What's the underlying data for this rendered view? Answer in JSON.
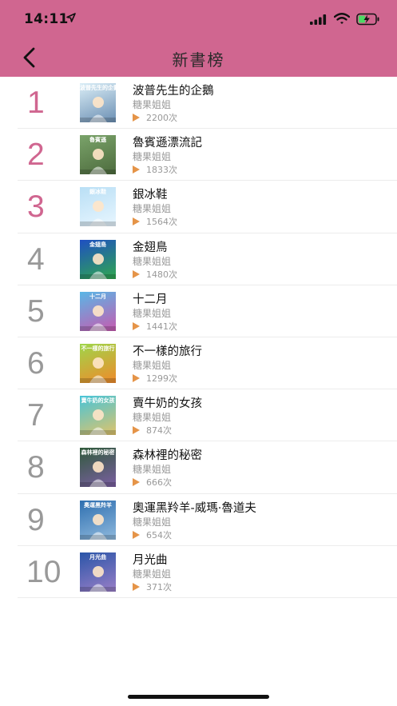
{
  "status_bar": {
    "time": "14:11"
  },
  "nav": {
    "title": "新書榜"
  },
  "books": [
    {
      "rank": "1",
      "title": "波普先生的企鵝",
      "author": "糖果姐姐",
      "plays": "2200次",
      "cover_text": "波普先生的企鵝",
      "cover_colors": [
        "#dbeef7",
        "#6b8fb3"
      ]
    },
    {
      "rank": "2",
      "title": "魯賓遜漂流記",
      "author": "糖果姐姐",
      "plays": "1833次",
      "cover_text": "魯賓遜",
      "cover_colors": [
        "#7aa36a",
        "#4d6b3d"
      ]
    },
    {
      "rank": "3",
      "title": "銀冰鞋",
      "author": "糖果姐姐",
      "plays": "1564次",
      "cover_text": "銀冰鞋",
      "cover_colors": [
        "#b9dff5",
        "#e8f6ff"
      ]
    },
    {
      "rank": "4",
      "title": "金翅鳥",
      "author": "糖果姐姐",
      "plays": "1480次",
      "cover_text": "金翅鳥",
      "cover_colors": [
        "#1f4fc2",
        "#2fa84f"
      ]
    },
    {
      "rank": "5",
      "title": "十二月",
      "author": "糖果姐姐",
      "plays": "1441次",
      "cover_text": "十二月",
      "cover_colors": [
        "#59b7e6",
        "#c75ab0"
      ]
    },
    {
      "rank": "6",
      "title": "不一樣的旅行",
      "author": "糖果姐姐",
      "plays": "1299次",
      "cover_text": "不一樣的旅行",
      "cover_colors": [
        "#9ed64a",
        "#f08a2b"
      ]
    },
    {
      "rank": "7",
      "title": "賣牛奶的女孩",
      "author": "糖果姐姐",
      "plays": "874次",
      "cover_text": "賣牛奶的女孩",
      "cover_colors": [
        "#46c4d9",
        "#e0c46a"
      ]
    },
    {
      "rank": "8",
      "title": "森林裡的秘密",
      "author": "糖果姐姐",
      "plays": "666次",
      "cover_text": "森林裡的秘密",
      "cover_colors": [
        "#2f5a3a",
        "#7c5fa3"
      ]
    },
    {
      "rank": "9",
      "title": "奧運黑羚羊-威瑪·魯道夫",
      "author": "糖果姐姐",
      "plays": "654次",
      "cover_text": "奧運黑羚羊",
      "cover_colors": [
        "#2e6fb0",
        "#8fb9dd"
      ]
    },
    {
      "rank": "10",
      "title": "月光曲",
      "author": "糖果姐姐",
      "plays": "371次",
      "cover_text": "月光曲",
      "cover_colors": [
        "#2a55a8",
        "#9a7fc7"
      ]
    }
  ],
  "colors": {
    "header": "#d06690",
    "top_rank": "#d06690",
    "rank": "#999999",
    "play_icon": "#e59448"
  }
}
